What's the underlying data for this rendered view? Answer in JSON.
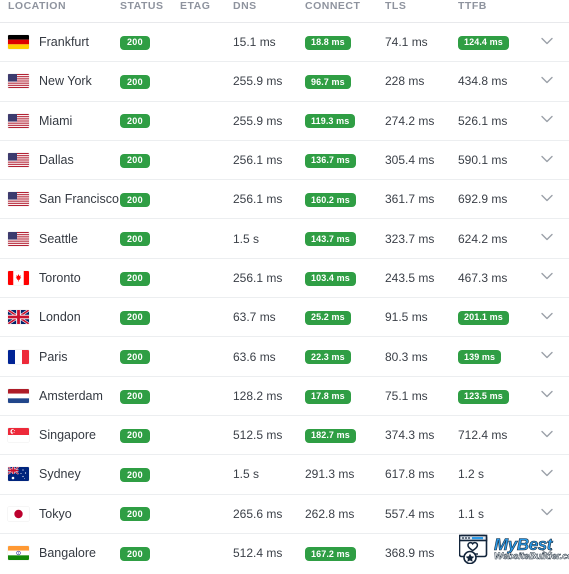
{
  "table": {
    "columns": [
      {
        "key": "location",
        "label": "LOCATION"
      },
      {
        "key": "status",
        "label": "STATUS"
      },
      {
        "key": "etag",
        "label": "ETAG"
      },
      {
        "key": "dns",
        "label": "DNS"
      },
      {
        "key": "connect",
        "label": "CONNECT"
      },
      {
        "key": "tls",
        "label": "TLS"
      },
      {
        "key": "ttfb",
        "label": "TTFB"
      }
    ],
    "rows": [
      {
        "location": "Frankfurt",
        "flag": "flag-de",
        "status": "200",
        "etag": "",
        "dns": "15.1 ms",
        "dns_badge": false,
        "connect": "18.8 ms",
        "connect_badge": true,
        "tls": "74.1 ms",
        "tls_badge": false,
        "ttfb": "124.4 ms",
        "ttfb_badge": true,
        "toggle": "chevron-down-icon"
      },
      {
        "location": "New York",
        "flag": "flag-us",
        "status": "200",
        "etag": "",
        "dns": "255.9 ms",
        "dns_badge": false,
        "connect": "96.7 ms",
        "connect_badge": true,
        "tls": "228 ms",
        "tls_badge": false,
        "ttfb": "434.8 ms",
        "ttfb_badge": false,
        "toggle": "chevron-down-icon"
      },
      {
        "location": "Miami",
        "flag": "flag-us",
        "status": "200",
        "etag": "",
        "dns": "255.9 ms",
        "dns_badge": false,
        "connect": "119.3 ms",
        "connect_badge": true,
        "tls": "274.2 ms",
        "tls_badge": false,
        "ttfb": "526.1 ms",
        "ttfb_badge": false,
        "toggle": "chevron-down-icon"
      },
      {
        "location": "Dallas",
        "flag": "flag-us",
        "status": "200",
        "etag": "",
        "dns": "256.1 ms",
        "dns_badge": false,
        "connect": "136.7 ms",
        "connect_badge": true,
        "tls": "305.4 ms",
        "tls_badge": false,
        "ttfb": "590.1 ms",
        "ttfb_badge": false,
        "toggle": "chevron-down-icon"
      },
      {
        "location": "San Francisco",
        "flag": "flag-us",
        "status": "200",
        "etag": "",
        "dns": "256.1 ms",
        "dns_badge": false,
        "connect": "160.2 ms",
        "connect_badge": true,
        "tls": "361.7 ms",
        "tls_badge": false,
        "ttfb": "692.9 ms",
        "ttfb_badge": false,
        "toggle": "chevron-down-icon"
      },
      {
        "location": "Seattle",
        "flag": "flag-us",
        "status": "200",
        "etag": "",
        "dns": "1.5 s",
        "dns_badge": false,
        "connect": "143.7 ms",
        "connect_badge": true,
        "tls": "323.7 ms",
        "tls_badge": false,
        "ttfb": "624.2 ms",
        "ttfb_badge": false,
        "toggle": "chevron-down-icon"
      },
      {
        "location": "Toronto",
        "flag": "flag-ca",
        "status": "200",
        "etag": "",
        "dns": "256.1 ms",
        "dns_badge": false,
        "connect": "103.4 ms",
        "connect_badge": true,
        "tls": "243.5 ms",
        "tls_badge": false,
        "ttfb": "467.3 ms",
        "ttfb_badge": false,
        "toggle": "chevron-down-icon"
      },
      {
        "location": "London",
        "flag": "flag-gb",
        "status": "200",
        "etag": "",
        "dns": "63.7 ms",
        "dns_badge": false,
        "connect": "25.2 ms",
        "connect_badge": true,
        "tls": "91.5 ms",
        "tls_badge": false,
        "ttfb": "201.1 ms",
        "ttfb_badge": true,
        "toggle": "chevron-down-icon"
      },
      {
        "location": "Paris",
        "flag": "flag-fr",
        "status": "200",
        "etag": "",
        "dns": "63.6 ms",
        "dns_badge": false,
        "connect": "22.3 ms",
        "connect_badge": true,
        "tls": "80.3 ms",
        "tls_badge": false,
        "ttfb": "139 ms",
        "ttfb_badge": true,
        "toggle": "chevron-down-icon"
      },
      {
        "location": "Amsterdam",
        "flag": "flag-nl",
        "status": "200",
        "etag": "",
        "dns": "128.2 ms",
        "dns_badge": false,
        "connect": "17.8 ms",
        "connect_badge": true,
        "tls": "75.1 ms",
        "tls_badge": false,
        "ttfb": "123.5 ms",
        "ttfb_badge": true,
        "toggle": "chevron-down-icon"
      },
      {
        "location": "Singapore",
        "flag": "flag-sg",
        "status": "200",
        "etag": "",
        "dns": "512.5 ms",
        "dns_badge": false,
        "connect": "182.7 ms",
        "connect_badge": true,
        "tls": "374.3 ms",
        "tls_badge": false,
        "ttfb": "712.4 ms",
        "ttfb_badge": false,
        "toggle": "chevron-down-icon"
      },
      {
        "location": "Sydney",
        "flag": "flag-au",
        "status": "200",
        "etag": "",
        "dns": "1.5 s",
        "dns_badge": false,
        "connect": "291.3 ms",
        "connect_badge": false,
        "tls": "617.8 ms",
        "tls_badge": false,
        "ttfb": "1.2 s",
        "ttfb_badge": false,
        "toggle": "chevron-down-icon"
      },
      {
        "location": "Tokyo",
        "flag": "flag-jp",
        "status": "200",
        "etag": "",
        "dns": "265.6 ms",
        "dns_badge": false,
        "connect": "262.8 ms",
        "connect_badge": false,
        "tls": "557.4 ms",
        "tls_badge": false,
        "ttfb": "1.1 s",
        "ttfb_badge": false,
        "toggle": "chevron-down-icon"
      },
      {
        "location": "Bangalore",
        "flag": "flag-in",
        "status": "200",
        "etag": "",
        "dns": "512.4 ms",
        "dns_badge": false,
        "connect": "167.2 ms",
        "connect_badge": true,
        "tls": "368.9 ms",
        "tls_badge": false,
        "ttfb": "",
        "ttfb_badge": false,
        "toggle": "chevron-down-icon"
      }
    ]
  },
  "watermark": {
    "line1": "MyBest",
    "line2": "WebsiteBuilder.com",
    "icon": "browser-window-star-icon"
  },
  "colors": {
    "badge_green": "#2f9e44",
    "header_text": "#8e939e",
    "body_text": "#3a3f47",
    "row_border": "#eceef0",
    "watermark_blue": "#2b9ae8"
  }
}
